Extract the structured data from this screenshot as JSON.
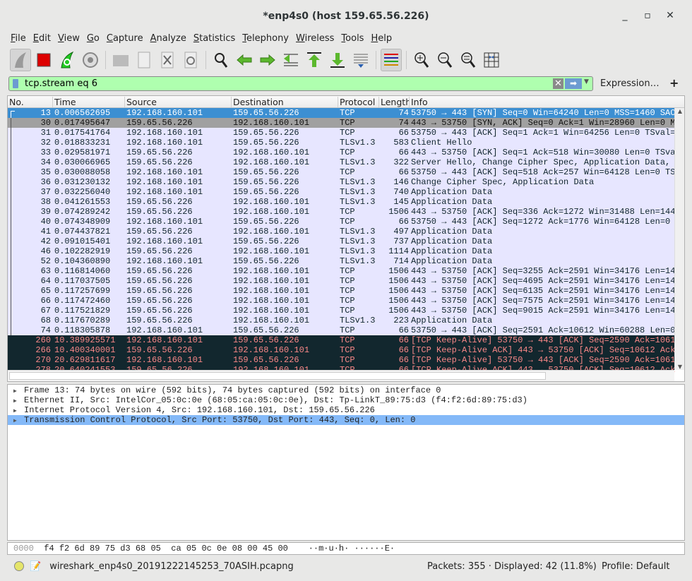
{
  "window": {
    "title": "*enp4s0 (host 159.65.56.226)"
  },
  "menu": [
    "File",
    "Edit",
    "View",
    "Go",
    "Capture",
    "Analyze",
    "Statistics",
    "Telephony",
    "Wireless",
    "Tools",
    "Help"
  ],
  "toolbar": {
    "icons": [
      "start-capture-icon",
      "stop-capture-icon",
      "restart-capture-icon",
      "capture-options-icon",
      "open-file-icon",
      "save-file-icon",
      "close-file-icon",
      "reload-file-icon",
      "find-packet-icon",
      "go-back-icon",
      "go-forward-icon",
      "go-to-packet-icon",
      "go-first-icon",
      "go-last-icon",
      "auto-scroll-icon",
      "colorize-icon",
      "zoom-in-icon",
      "zoom-out-icon",
      "zoom-normal-icon",
      "resize-columns-icon"
    ]
  },
  "filter": {
    "value": "tcp.stream eq 6",
    "expression_label": "Expression…",
    "plus_label": "+",
    "bg_color": "#afffaf"
  },
  "columns": [
    "No.",
    "Time",
    "Source",
    "Destination",
    "Protocol",
    "Length",
    "Info"
  ],
  "packets": [
    {
      "no": "13",
      "time": "0.006562695",
      "src": "192.168.160.101",
      "dst": "159.65.56.226",
      "proto": "TCP",
      "len": "74",
      "info": "53750 → 443 [SYN] Seq=0 Win=64240 Len=0 MSS=1460 SAC",
      "style": "sel"
    },
    {
      "no": "30",
      "time": "0.017495647",
      "src": "159.65.56.226",
      "dst": "192.168.160.101",
      "proto": "TCP",
      "len": "74",
      "info": "443 → 53750 [SYN, ACK] Seq=0 Ack=1 Win=28960 Len=0 M",
      "style": "grey"
    },
    {
      "no": "31",
      "time": "0.017541764",
      "src": "192.168.160.101",
      "dst": "159.65.56.226",
      "proto": "TCP",
      "len": "66",
      "info": "53750 → 443 [ACK] Seq=1 Ack=1 Win=64256 Len=0 TSval=",
      "style": ""
    },
    {
      "no": "32",
      "time": "0.018833231",
      "src": "192.168.160.101",
      "dst": "159.65.56.226",
      "proto": "TLSv1.3",
      "len": "583",
      "info": "Client Hello",
      "style": ""
    },
    {
      "no": "33",
      "time": "0.029581971",
      "src": "159.65.56.226",
      "dst": "192.168.160.101",
      "proto": "TCP",
      "len": "66",
      "info": "443 → 53750 [ACK] Seq=1 Ack=518 Win=30080 Len=0 TSva",
      "style": ""
    },
    {
      "no": "34",
      "time": "0.030066965",
      "src": "159.65.56.226",
      "dst": "192.168.160.101",
      "proto": "TLSv1.3",
      "len": "322",
      "info": "Server Hello, Change Cipher Spec, Application Data,",
      "style": ""
    },
    {
      "no": "35",
      "time": "0.030088058",
      "src": "192.168.160.101",
      "dst": "159.65.56.226",
      "proto": "TCP",
      "len": "66",
      "info": "53750 → 443 [ACK] Seq=518 Ack=257 Win=64128 Len=0 TS",
      "style": ""
    },
    {
      "no": "36",
      "time": "0.031230132",
      "src": "192.168.160.101",
      "dst": "159.65.56.226",
      "proto": "TLSv1.3",
      "len": "146",
      "info": "Change Cipher Spec, Application Data",
      "style": ""
    },
    {
      "no": "37",
      "time": "0.032256040",
      "src": "192.168.160.101",
      "dst": "159.65.56.226",
      "proto": "TLSv1.3",
      "len": "740",
      "info": "Application Data",
      "style": ""
    },
    {
      "no": "38",
      "time": "0.041261553",
      "src": "159.65.56.226",
      "dst": "192.168.160.101",
      "proto": "TLSv1.3",
      "len": "145",
      "info": "Application Data",
      "style": ""
    },
    {
      "no": "39",
      "time": "0.074289242",
      "src": "159.65.56.226",
      "dst": "192.168.160.101",
      "proto": "TCP",
      "len": "1506",
      "info": "443 → 53750 [ACK] Seq=336 Ack=1272 Win=31488 Len=144",
      "style": ""
    },
    {
      "no": "40",
      "time": "0.074348909",
      "src": "192.168.160.101",
      "dst": "159.65.56.226",
      "proto": "TCP",
      "len": "66",
      "info": "53750 → 443 [ACK] Seq=1272 Ack=1776 Win=64128 Len=0",
      "style": ""
    },
    {
      "no": "41",
      "time": "0.074437821",
      "src": "159.65.56.226",
      "dst": "192.168.160.101",
      "proto": "TLSv1.3",
      "len": "497",
      "info": "Application Data",
      "style": ""
    },
    {
      "no": "42",
      "time": "0.091015401",
      "src": "192.168.160.101",
      "dst": "159.65.56.226",
      "proto": "TLSv1.3",
      "len": "737",
      "info": "Application Data",
      "style": ""
    },
    {
      "no": "46",
      "time": "0.102282919",
      "src": "159.65.56.226",
      "dst": "192.168.160.101",
      "proto": "TLSv1.3",
      "len": "1114",
      "info": "Application Data",
      "style": ""
    },
    {
      "no": "52",
      "time": "0.104360890",
      "src": "192.168.160.101",
      "dst": "159.65.56.226",
      "proto": "TLSv1.3",
      "len": "714",
      "info": "Application Data",
      "style": ""
    },
    {
      "no": "63",
      "time": "0.116814060",
      "src": "159.65.56.226",
      "dst": "192.168.160.101",
      "proto": "TCP",
      "len": "1506",
      "info": "443 → 53750 [ACK] Seq=3255 Ack=2591 Win=34176 Len=14",
      "style": ""
    },
    {
      "no": "64",
      "time": "0.117037505",
      "src": "159.65.56.226",
      "dst": "192.168.160.101",
      "proto": "TCP",
      "len": "1506",
      "info": "443 → 53750 [ACK] Seq=4695 Ack=2591 Win=34176 Len=14",
      "style": ""
    },
    {
      "no": "65",
      "time": "0.117257699",
      "src": "159.65.56.226",
      "dst": "192.168.160.101",
      "proto": "TCP",
      "len": "1506",
      "info": "443 → 53750 [ACK] Seq=6135 Ack=2591 Win=34176 Len=14",
      "style": ""
    },
    {
      "no": "66",
      "time": "0.117472460",
      "src": "159.65.56.226",
      "dst": "192.168.160.101",
      "proto": "TCP",
      "len": "1506",
      "info": "443 → 53750 [ACK] Seq=7575 Ack=2591 Win=34176 Len=14",
      "style": ""
    },
    {
      "no": "67",
      "time": "0.117521829",
      "src": "159.65.56.226",
      "dst": "192.168.160.101",
      "proto": "TCP",
      "len": "1506",
      "info": "443 → 53750 [ACK] Seq=9015 Ack=2591 Win=34176 Len=14",
      "style": ""
    },
    {
      "no": "68",
      "time": "0.117670289",
      "src": "159.65.56.226",
      "dst": "192.168.160.101",
      "proto": "TLSv1.3",
      "len": "223",
      "info": "Application Data",
      "style": ""
    },
    {
      "no": "74",
      "time": "0.118305878",
      "src": "192.168.160.101",
      "dst": "159.65.56.226",
      "proto": "TCP",
      "len": "66",
      "info": "53750 → 443 [ACK] Seq=2591 Ack=10612 Win=60288 Len=0",
      "style": ""
    },
    {
      "no": "260",
      "time": "10.389925571",
      "src": "192.168.160.101",
      "dst": "159.65.56.226",
      "proto": "TCP",
      "len": "66",
      "info": "[TCP Keep-Alive] 53750 → 443 [ACK] Seq=2590 Ack=1061",
      "style": "ka"
    },
    {
      "no": "266",
      "time": "10.400340001",
      "src": "159.65.56.226",
      "dst": "192.168.160.101",
      "proto": "TCP",
      "len": "66",
      "info": "[TCP Keep-Alive ACK] 443 → 53750 [ACK] Seq=10612 Ack",
      "style": "ka"
    },
    {
      "no": "270",
      "time": "20.629811617",
      "src": "192.168.160.101",
      "dst": "159.65.56.226",
      "proto": "TCP",
      "len": "66",
      "info": "[TCP Keep-Alive] 53750 → 443 [ACK] Seq=2590 Ack=1061",
      "style": "ka"
    },
    {
      "no": "278",
      "time": "20.640241553",
      "src": "159.65.56.226",
      "dst": "192.168.160.101",
      "proto": "TCP",
      "len": "66",
      "info": "[TCP Keep-Alive ACK] 443 → 53750 [ACK] Seq=10612 Ack",
      "style": "ka"
    }
  ],
  "details": [
    "Frame 13: 74 bytes on wire (592 bits), 74 bytes captured (592 bits) on interface 0",
    "Ethernet II, Src: IntelCor_05:0c:0e (68:05:ca:05:0c:0e), Dst: Tp-LinkT_89:75:d3 (f4:f2:6d:89:75:d3)",
    "Internet Protocol Version 4, Src: 192.168.160.101, Dst: 159.65.56.226",
    "Transmission Control Protocol, Src Port: 53750, Dst Port: 443, Seq: 0, Len: 0"
  ],
  "bytes": {
    "offset": "0000",
    "hex": "f4 f2 6d 89 75 d3 68 05  ca 05 0c 0e 08 00 45 00",
    "ascii": "··m·u·h· ······E·"
  },
  "status": {
    "file": "wireshark_enp4s0_20191222145253_70ASIH.pcapng",
    "packets": "Packets: 355 · Displayed: 42 (11.8%)",
    "profile": "Profile: Default"
  },
  "colors": {
    "selected": "#3c8fd2",
    "normal": "#e7e6ff",
    "keepalive_bg": "#12272e",
    "keepalive_fg": "#f78787"
  }
}
